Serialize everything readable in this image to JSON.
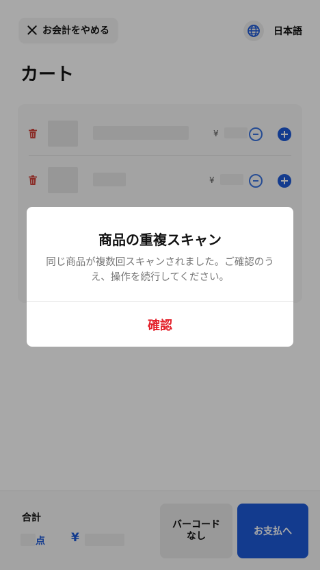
{
  "header": {
    "cancel_label": "お会計をやめる",
    "language_label": "日本語"
  },
  "page_title": "カート",
  "cart": {
    "items": [
      {
        "currency": "¥"
      },
      {
        "currency": "¥"
      }
    ]
  },
  "footer": {
    "total_label": "合計",
    "count_unit": "点",
    "currency": "¥",
    "no_barcode_label": "バーコード\nなし",
    "pay_label": "お支払へ"
  },
  "dialog": {
    "title": "商品の重複スキャン",
    "message": "同じ商品が複数回スキャンされました。ご確認のうえ、操作を続行してください。",
    "confirm_label": "確認"
  },
  "colors": {
    "accent": "#1e5ad8",
    "danger": "#e3202a",
    "overlay": "#000000"
  }
}
